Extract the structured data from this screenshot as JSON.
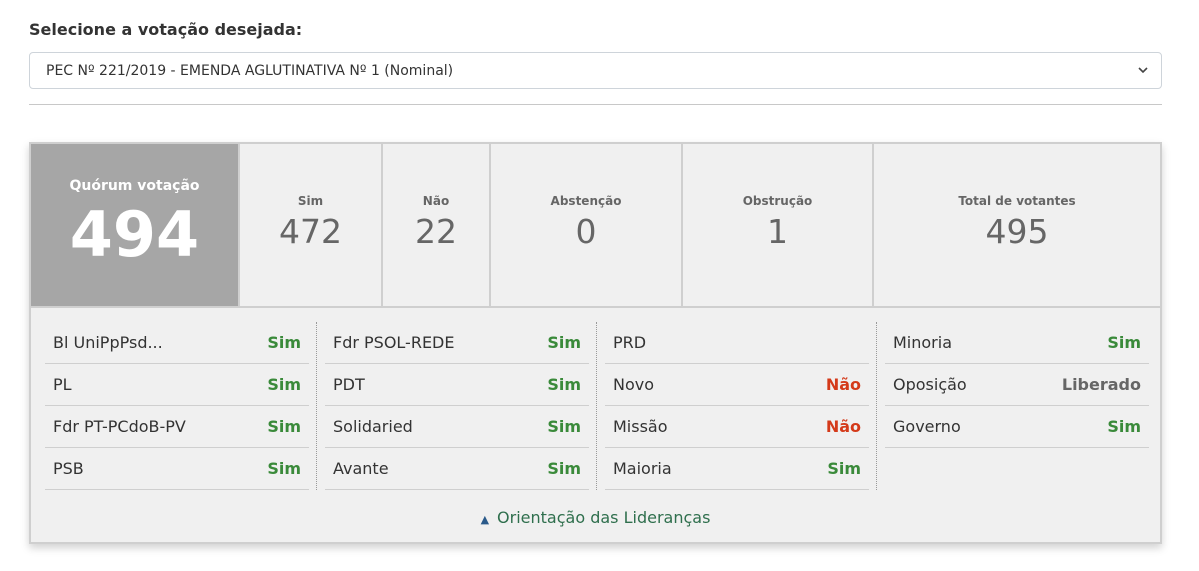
{
  "selector": {
    "label": "Selecione a votação desejada:",
    "selected": "PEC Nº 221/2019 - EMENDA AGLUTINATIVA Nº 1 (Nominal)"
  },
  "quorum": {
    "label": "Quórum votação",
    "value": "494"
  },
  "stats": [
    {
      "label": "Sim",
      "value": "472"
    },
    {
      "label": "Não",
      "value": "22"
    },
    {
      "label": "Abstenção",
      "value": "0"
    },
    {
      "label": "Obstrução",
      "value": "1"
    },
    {
      "label": "Total de votantes",
      "value": "495"
    }
  ],
  "orientation": {
    "columns": [
      [
        {
          "party": "Bl UniPpPsd...",
          "vote": "Sim"
        },
        {
          "party": "PL",
          "vote": "Sim"
        },
        {
          "party": "Fdr PT-PCdoB-PV",
          "vote": "Sim"
        },
        {
          "party": "PSB",
          "vote": "Sim"
        }
      ],
      [
        {
          "party": "Fdr PSOL-REDE",
          "vote": "Sim"
        },
        {
          "party": "PDT",
          "vote": "Sim"
        },
        {
          "party": "Solidaried",
          "vote": "Sim"
        },
        {
          "party": "Avante",
          "vote": "Sim"
        }
      ],
      [
        {
          "party": "PRD",
          "vote": ""
        },
        {
          "party": "Novo",
          "vote": "Não"
        },
        {
          "party": "Missão",
          "vote": "Não"
        },
        {
          "party": "Maioria",
          "vote": "Sim"
        }
      ],
      [
        {
          "party": "Minoria",
          "vote": "Sim"
        },
        {
          "party": "Oposição",
          "vote": "Liberado"
        },
        {
          "party": "Governo",
          "vote": "Sim"
        }
      ]
    ],
    "toggle_label": "Orientação das Lideranças"
  },
  "colors": {
    "sim": "#3a8a3a",
    "nao": "#d43a1a",
    "liberado": "#666666",
    "quorum_bg": "#a6a6a6"
  },
  "icons": {
    "select": "chevron-down-icon",
    "toggle": "triangle-up-icon"
  }
}
